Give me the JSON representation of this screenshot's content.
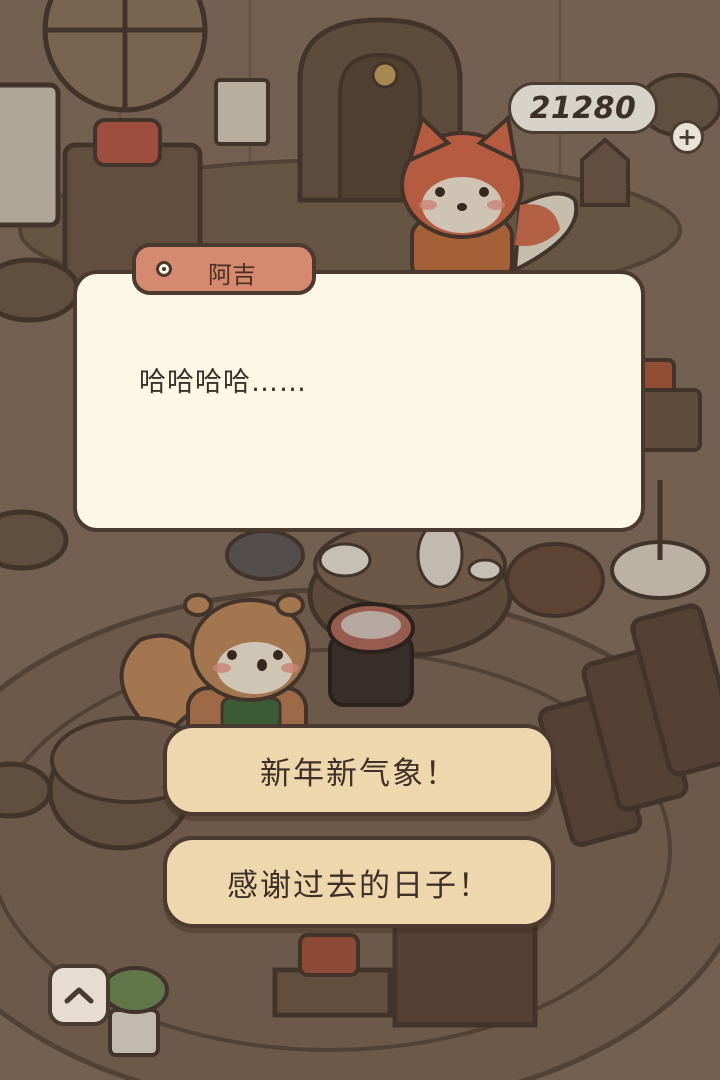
{
  "dialog": {
    "speaker": "阿吉",
    "text": "哈哈哈哈……"
  },
  "choices": [
    {
      "label": "新年新气象！"
    },
    {
      "label": "感谢过去的日子！"
    }
  ],
  "hud": {
    "currency": "21280",
    "add_icon": "plus-icon",
    "collapse_icon": "chevron-up-icon"
  },
  "colors": {
    "dialog_bg": "#fdf8e6",
    "name_tag_bg": "#d58a6f",
    "choice_bg": "#efd7ad",
    "outline": "#4a3a30"
  }
}
